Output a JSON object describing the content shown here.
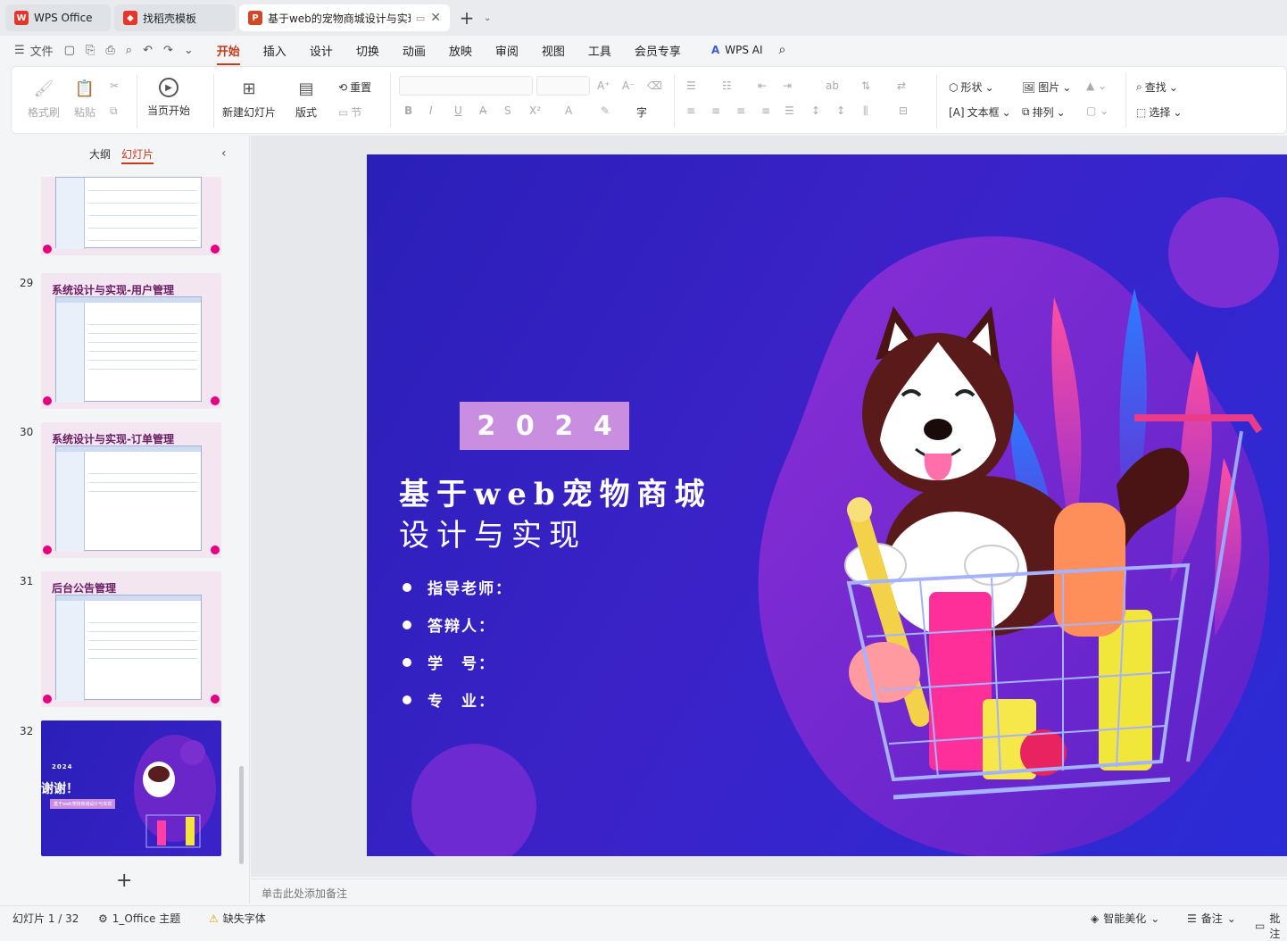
{
  "tabs": [
    {
      "label": "WPS Office"
    },
    {
      "label": "找稻壳模板"
    },
    {
      "label": "基于web的宠物商城设计与实现"
    }
  ],
  "menu": {
    "file": "文件",
    "items": [
      "开始",
      "插入",
      "设计",
      "切换",
      "动画",
      "放映",
      "审阅",
      "视图",
      "工具",
      "会员专享"
    ],
    "active": "开始",
    "ai": "WPS AI"
  },
  "ribbon": {
    "format_painter": "格式刷",
    "paste": "粘贴",
    "from_current": "当页开始",
    "new_slide": "新建幻灯片",
    "layout": "版式",
    "reset": "重置",
    "section": "节",
    "shape": "形状",
    "picture": "图片",
    "textbox": "文本框",
    "arrange": "排列",
    "find": "查找",
    "select": "选择"
  },
  "side": {
    "tab_outline": "大纲",
    "tab_slides": "幻灯片",
    "slides": [
      {
        "num": "29",
        "title": "系统设计与实现-用户管理"
      },
      {
        "num": "30",
        "title": "系统设计与实现-订单管理"
      },
      {
        "num": "31",
        "title": "后台公告管理"
      },
      {
        "num": "32",
        "year": "2024",
        "thanks": "谢谢！",
        "subtitle": "基于web宠物商城设计与实现"
      }
    ]
  },
  "slide": {
    "year_digits": [
      "2",
      "0",
      "2",
      "4"
    ],
    "title_line1": "基于web宠物商城",
    "title_line2": "设计与实现",
    "bullets": [
      "指导老师：",
      "答辩人：",
      "学　号：",
      "专　业："
    ]
  },
  "notes_placeholder": "单击此处添加备注",
  "status": {
    "slide_count": "幻灯片 1 / 32",
    "theme": "1_Office 主题",
    "missing_font": "缺失字体",
    "beautify": "智能美化",
    "notes": "备注",
    "comments": "批注"
  }
}
